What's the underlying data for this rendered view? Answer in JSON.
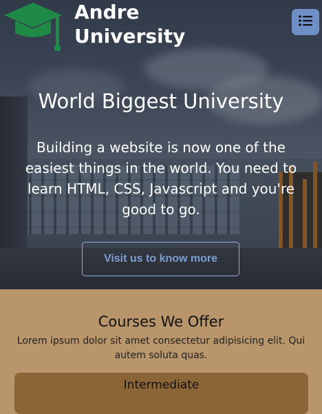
{
  "header": {
    "brand_line1": "Andre",
    "brand_line2": "University",
    "logo_icon": "graduation-cap-icon",
    "menu_icon": "list-icon"
  },
  "hero": {
    "title": "World Biggest University",
    "text": "Building a website is now one of the easiest things in the world. You need to learn HTML, CSS, Javascript and you're good to go.",
    "cta_label": "Visit us to know more"
  },
  "courses": {
    "title": "Courses We Offer",
    "description": "Lorem ipsum dolor sit amet consectetur adipisicing elit. Qui autem soluta quas.",
    "cards": [
      {
        "title": "Intermediate"
      }
    ]
  },
  "colors": {
    "logo_green": "#1f8a46",
    "menu_button": "#6e90c6",
    "cta_text": "#7e9fd4",
    "section_bg": "#b8956a",
    "card_bg": "#8c6537"
  }
}
